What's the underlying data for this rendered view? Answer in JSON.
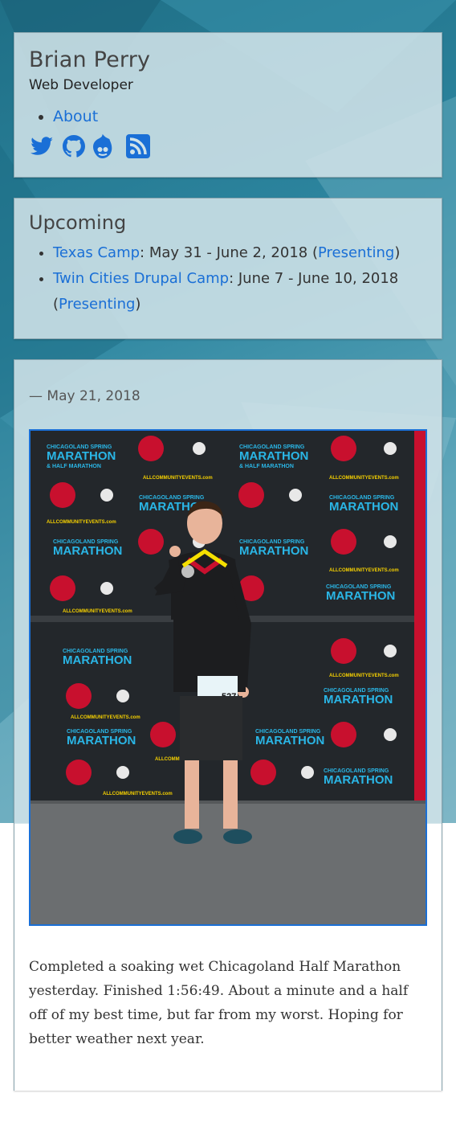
{
  "header": {
    "site_name": "Brian Perry",
    "site_slogan": "Web Developer",
    "nav": [
      {
        "label": "About"
      }
    ],
    "social_icons": [
      "twitter-icon",
      "github-icon",
      "drupal-icon",
      "rss-icon"
    ],
    "link_color": "#1a6fd6"
  },
  "upcoming": {
    "title": "Upcoming",
    "items": [
      {
        "event": "Texas Camp",
        "dates": ": May 31 - June 2, 2018 (",
        "role": "Presenting",
        "close": ")"
      },
      {
        "event": "Twin Cities Drupal Camp",
        "dates": ": June 7 - June 10, 2018 (",
        "role": "Presenting",
        "close": ")"
      }
    ]
  },
  "post": {
    "date": "— May 21, 2018",
    "photo": {
      "banner_line1": "CHICAGOLAND SPRING",
      "banner_line2": "MARATHON",
      "banner_line3": "& HALF MARATHON",
      "banner_site": "ALLCOMMUNITYEVENTS.com",
      "bib_number": "527"
    },
    "body": "Completed a soaking wet Chicagoland Half Marathon yesterday. Finished 1:56:49. About a minute and a half off of my best time, but far from my worst. Hoping for better weather next year."
  }
}
